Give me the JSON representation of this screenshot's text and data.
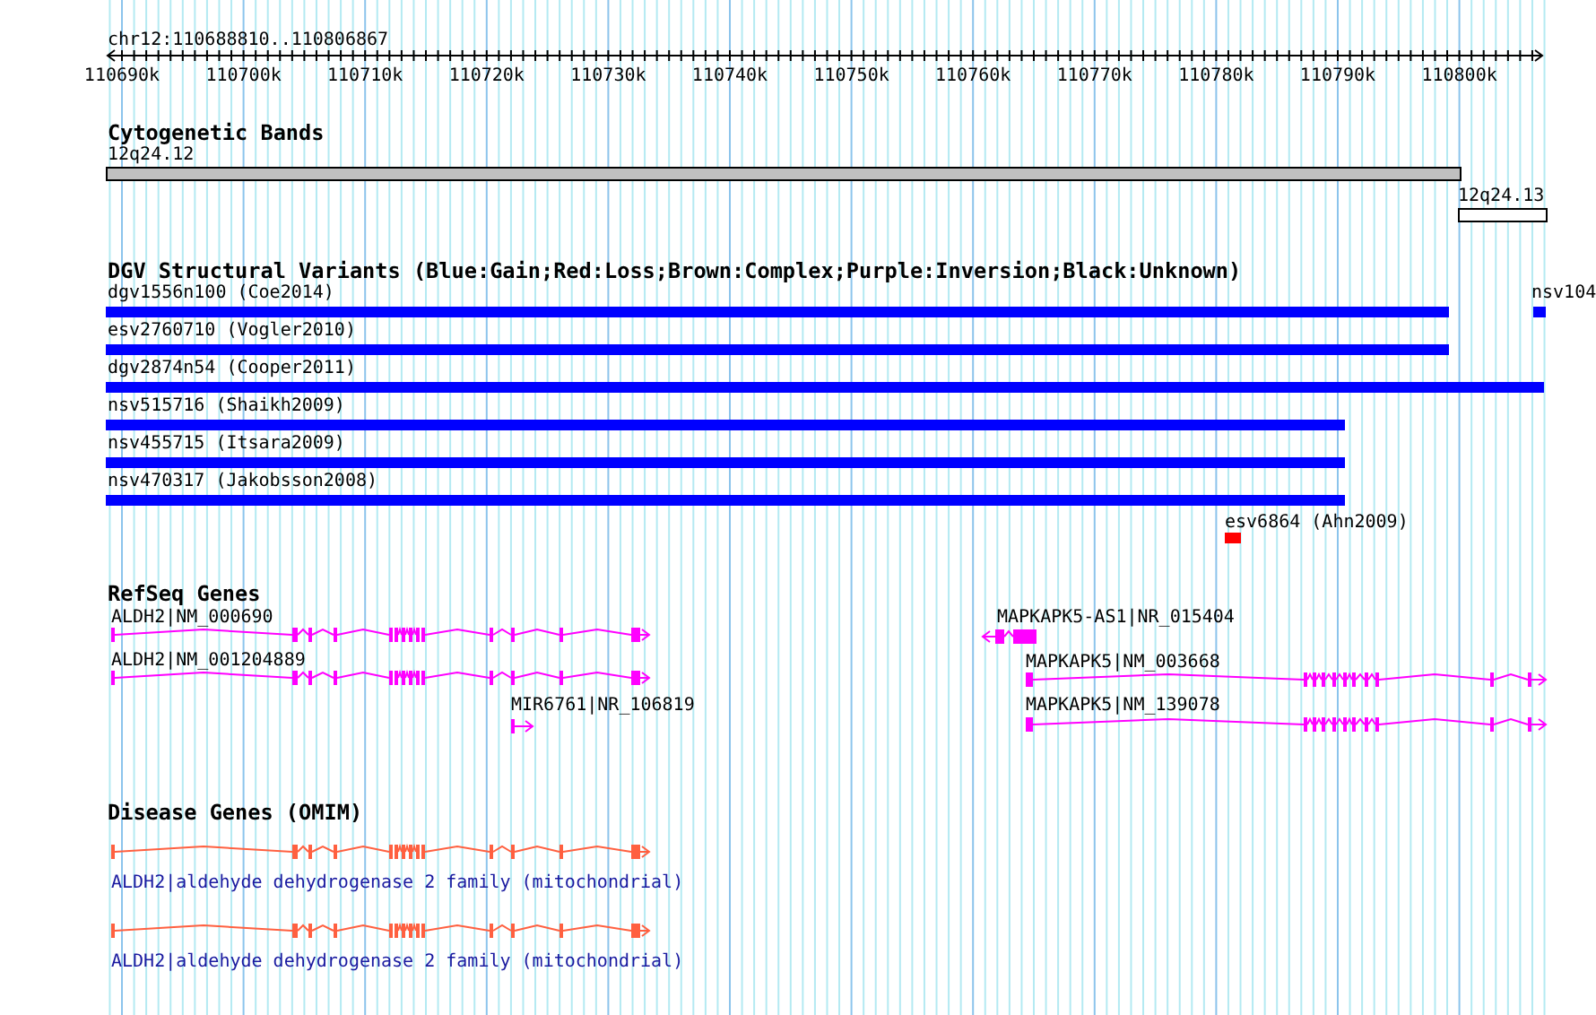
{
  "ruler": {
    "region": "chr12:110688810..110806867",
    "ticks": [
      "110690k",
      "110700k",
      "110710k",
      "110720k",
      "110730k",
      "110740k",
      "110750k",
      "110760k",
      "110770k",
      "110780k",
      "110790k",
      "110800k"
    ]
  },
  "tracks": [
    {
      "kind": "bands",
      "title": "Cytogenetic Bands",
      "features": [
        {
          "label": "12q24.12",
          "color": "#c0c0c0"
        },
        {
          "label": "12q24.13",
          "color": "#ffffff"
        }
      ]
    },
    {
      "kind": "variants",
      "title": "DGV Structural Variants (Blue:Gain;Red:Loss;Brown:Complex;Purple:Inversion;Black:Unknown)",
      "features": [
        {
          "label": "dgv1556n100 (Coe2014)",
          "color": "#0000ff"
        },
        {
          "label": "nsv104",
          "color": "#0000ff"
        },
        {
          "label": "esv2760710 (Vogler2010)",
          "color": "#0000ff"
        },
        {
          "label": "dgv2874n54 (Cooper2011)",
          "color": "#0000ff"
        },
        {
          "label": "nsv515716 (Shaikh2009)",
          "color": "#0000ff"
        },
        {
          "label": "nsv455715 (Itsara2009)",
          "color": "#0000ff"
        },
        {
          "label": "nsv470317 (Jakobsson2008)",
          "color": "#0000ff"
        },
        {
          "label": "esv6864 (Ahn2009)",
          "color": "#ff0000"
        }
      ]
    },
    {
      "kind": "genes",
      "title": "RefSeq Genes",
      "features": [
        {
          "label": "ALDH2|NM_000690",
          "reverse": false
        },
        {
          "label": "ALDH2|NM_001204889",
          "reverse": false
        },
        {
          "label": "MIR6761|NR_106819",
          "reverse": false
        },
        {
          "label": "MAPKAPK5-AS1|NR_015404",
          "reverse": true
        },
        {
          "label": "MAPKAPK5|NM_003668",
          "reverse": false
        },
        {
          "label": "MAPKAPK5|NM_139078",
          "reverse": false
        }
      ]
    },
    {
      "kind": "disease",
      "title": "Disease Genes (OMIM)",
      "features": [
        {
          "label": "ALDH2|aldehyde dehydrogenase 2 family (mitochondrial)",
          "reverse": false
        },
        {
          "label": "ALDH2|aldehyde dehydrogenase 2 family (mitochondrial)",
          "reverse": false
        }
      ]
    }
  ]
}
